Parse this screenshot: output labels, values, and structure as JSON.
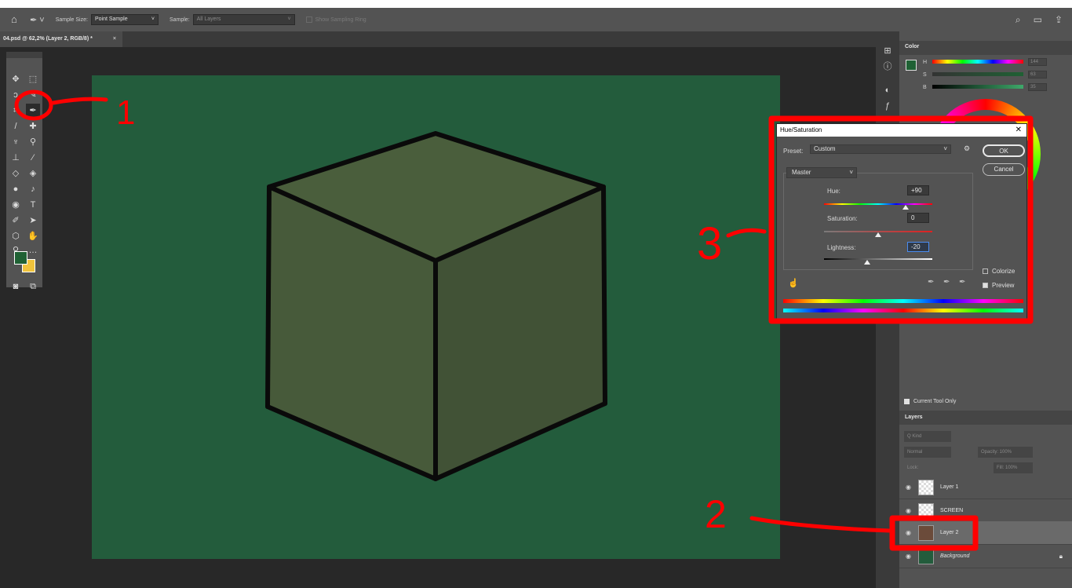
{
  "options_bar": {
    "sample_size_label": "Sample Size:",
    "sample_size_value": "Point Sample",
    "sample_label": "Sample:",
    "sample_value": "All Layers",
    "show_ring_label": "Show Sampling Ring"
  },
  "document": {
    "tab_title": "04.psd @ 62,2% (Layer 2, RGB/8) *",
    "tab_close": "×"
  },
  "color_panel": {
    "title": "Color",
    "h_label": "H",
    "s_label": "S",
    "b_label": "B",
    "h_value": "144",
    "s_value": "63",
    "b_value": "35",
    "pct": "%",
    "deg": "°"
  },
  "hue_saturation": {
    "title": "Hue/Saturation",
    "preset_label": "Preset:",
    "preset_value": "Custom",
    "ok": "OK",
    "cancel": "Cancel",
    "channel": "Master",
    "hue_label": "Hue:",
    "hue_value": "+90",
    "saturation_label": "Saturation:",
    "saturation_value": "0",
    "lightness_label": "Lightness:",
    "lightness_value": "-20",
    "colorize_label": "Colorize",
    "preview_label": "Preview",
    "hue_position": 0.75,
    "saturation_position": 0.5,
    "lightness_position": 0.4
  },
  "layers_panel": {
    "current_tool_only": "Current Tool Only",
    "title": "Layers",
    "kind": "Q Kind",
    "blend_mode": "Normal",
    "opacity": "Opacity: 100%",
    "lock_label": "Lock:",
    "fill": "Fill: 100%",
    "layers": [
      {
        "name": "Layer 1"
      },
      {
        "name": "SCREEN"
      },
      {
        "name": "Layer 2"
      },
      {
        "name": "Background"
      }
    ]
  },
  "annotations": {
    "one": "1",
    "two": "2",
    "three": "3"
  },
  "colors": {
    "canvas": "#235c3c",
    "cube_top": "#4a5e3c",
    "cube_left": "#475a3a",
    "cube_right": "#415236",
    "foreground": "#1f6134",
    "background": "#f0c33c",
    "annotation_red": "#ff0000"
  }
}
